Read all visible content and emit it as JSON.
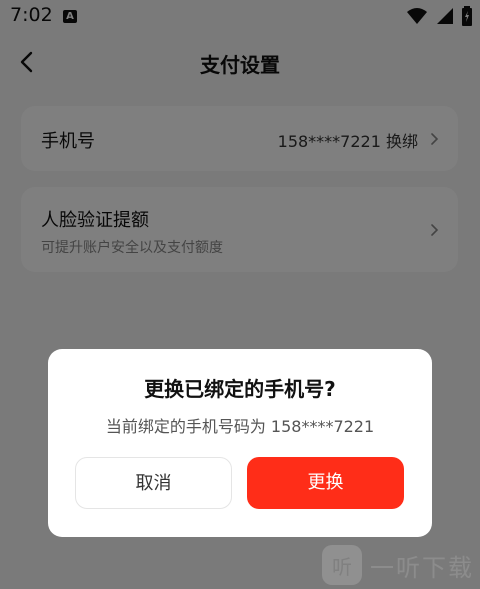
{
  "status_bar": {
    "time": "7:02",
    "notification_icon": "a-box-icon",
    "icons": [
      "wifi-icon",
      "signal-icon",
      "battery-charging-icon"
    ]
  },
  "header": {
    "title": "支付设置",
    "back_icon": "chevron-left-icon"
  },
  "settings": {
    "phone": {
      "label": "手机号",
      "value": "158****7221 换绑"
    },
    "face": {
      "label": "人脸验证提额",
      "subtitle": "可提升账户安全以及支付额度"
    }
  },
  "dialog": {
    "title": "更换已绑定的手机号?",
    "message": "当前绑定的手机号码为 158****7221",
    "cancel_label": "取消",
    "confirm_label": "更换"
  },
  "watermark": {
    "logo_glyph": "听",
    "text": "一听下载"
  },
  "colors": {
    "accent": "#ff2d18",
    "overlay": "rgba(0,0,0,0.5)",
    "card_bg": "#ffffff",
    "page_bg": "#f4f4f4"
  }
}
